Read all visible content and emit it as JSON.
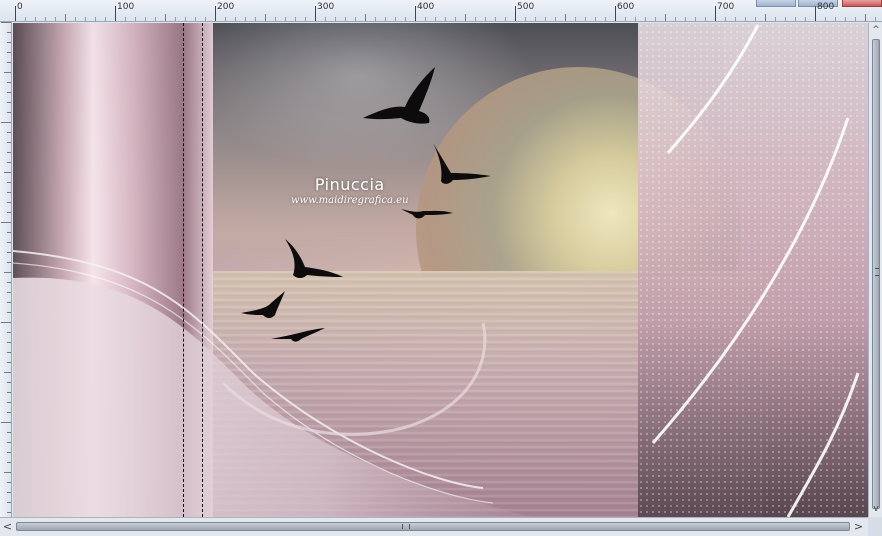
{
  "ruler": {
    "labels": [
      "0",
      "100",
      "200",
      "300",
      "400",
      "500",
      "600",
      "700",
      "800"
    ]
  },
  "watermark": {
    "name": "Pinuccia",
    "url": "www.maidiregrafica.eu"
  },
  "icons": {
    "left_arrow": "<",
    "right_arrow": ">",
    "up_arrow": "^",
    "down_arrow": "v"
  },
  "colors": {
    "canvas_pink": "#c9a9b4",
    "sky_dark": "#4d4e55",
    "moon": "#f3ecc1",
    "ruler_bg": "#eef2f8"
  }
}
